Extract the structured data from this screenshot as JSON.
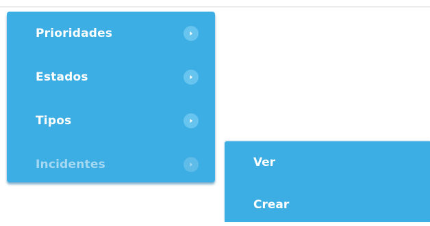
{
  "menu": {
    "items": [
      {
        "label": "Prioridades",
        "icon": "chevron-right-icon",
        "active": false
      },
      {
        "label": "Estados",
        "icon": "chevron-right-icon",
        "active": false
      },
      {
        "label": "Tipos",
        "icon": "chevron-right-icon",
        "active": false
      },
      {
        "label": "Incidentes",
        "icon": "chevron-right-icon",
        "active": true
      }
    ]
  },
  "submenu": {
    "items": [
      {
        "label": "Ver"
      },
      {
        "label": "Crear"
      }
    ]
  },
  "colors": {
    "menu_background": "#3daee3",
    "menu_text": "#ffffff",
    "active_text": "#a6d8f2",
    "arrow_circle": "#66c4ef"
  }
}
